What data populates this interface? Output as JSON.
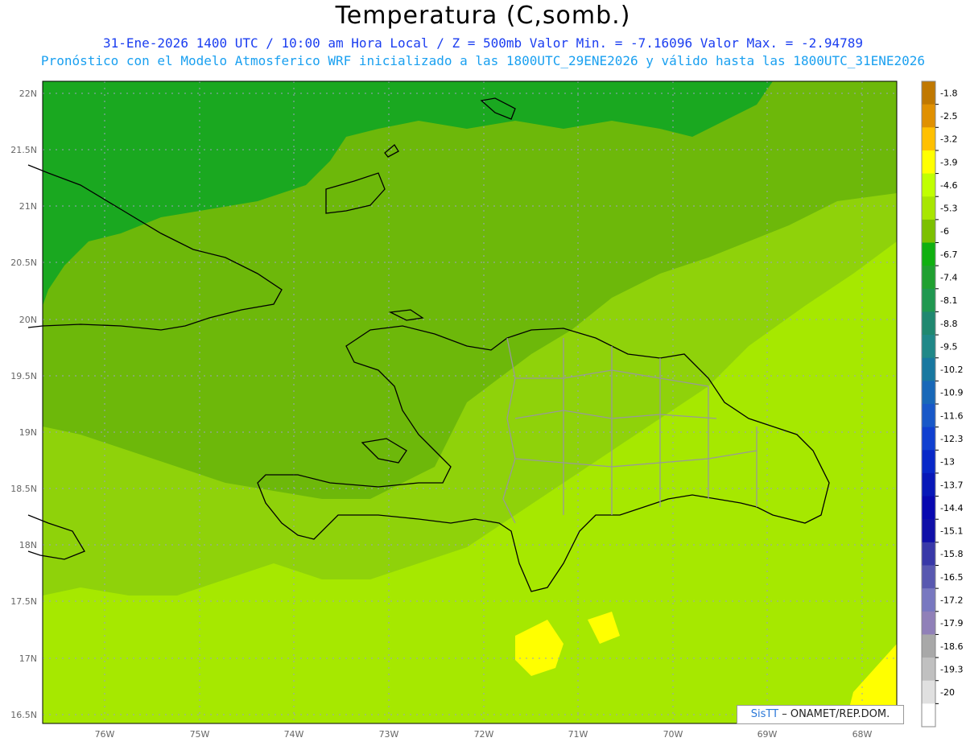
{
  "title": "Temperatura (C,somb.)",
  "subtitle_line1": "31-Ene-2026  1400 UTC / 10:00 am Hora Local / Z = 500mb  Valor Min. = -7.16096  Valor Max. = -2.94789",
  "subtitle_line2": "Pronóstico con el Modelo Atmosferico WRF inicializado a las 1800UTC_29ENE2026 y válido hasta las  1800UTC_31ENE2026",
  "lat_labels": [
    "22N",
    "21.5N",
    "21N",
    "20.5N",
    "20N",
    "19.5N",
    "19N",
    "18.5N",
    "18N",
    "17.5N",
    "17N",
    "16.5N"
  ],
  "lon_labels": [
    "76W",
    "75W",
    "74W",
    "73W",
    "72W",
    "71W",
    "70W",
    "69W",
    "68W"
  ],
  "colorbar": {
    "labels": [
      "-1.8",
      "-2.5",
      "-3.2",
      "-3.9",
      "-4.6",
      "-5.3",
      "-6",
      "-6.7",
      "-7.4",
      "-8.1",
      "-8.8",
      "-9.5",
      "-10.2",
      "-10.9",
      "-11.6",
      "-12.3",
      "-13",
      "-13.7",
      "-14.4",
      "-15.1",
      "-15.8",
      "-16.5",
      "-17.2",
      "-17.9",
      "-18.6",
      "-19.3",
      "-20"
    ],
    "colors": [
      "#c07800",
      "#e09000",
      "#ffc000",
      "#ffff00",
      "#c0ff00",
      "#a8e600",
      "#7cc000",
      "#10b010",
      "#20a030",
      "#209850",
      "#208870",
      "#208888",
      "#1878a0",
      "#1868b8",
      "#1858c8",
      "#1040d0",
      "#0828c8",
      "#0818b8",
      "#0808b0",
      "#1010a8",
      "#3838a8",
      "#5858b0",
      "#7878c0",
      "#9080b8",
      "#a8a8a8",
      "#c0c0c0",
      "#e0e0e0",
      "#ffffff"
    ]
  },
  "credit": {
    "logo": "SisTT",
    "text": "– ONAMET/REP.DOM."
  },
  "field_colors": {
    "dark_green": "#1aa820",
    "mid_green": "#6db80a",
    "light_green": "#8fd20a",
    "yellow_green": "#a6e800",
    "yellow": "#ffff00",
    "coast": "#000000",
    "borders": "#999999"
  }
}
